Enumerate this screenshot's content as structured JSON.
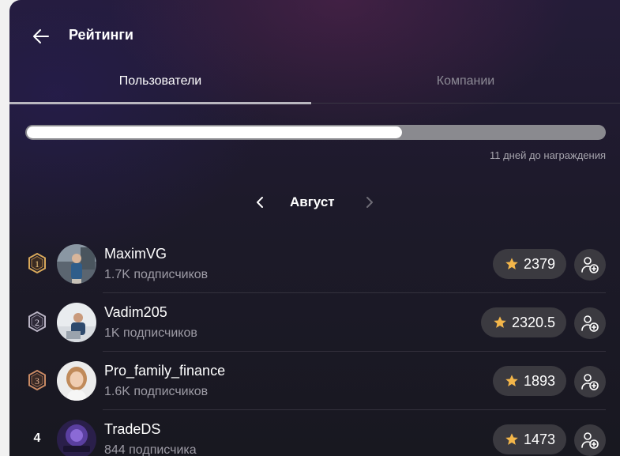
{
  "header": {
    "title": "Рейтинги"
  },
  "tabs": [
    {
      "label": "Пользователи",
      "active": true
    },
    {
      "label": "Компании",
      "active": false
    }
  ],
  "progress": {
    "fraction": 0.65,
    "label": "11 дней до награждения"
  },
  "month": {
    "label": "Август"
  },
  "colors": {
    "star": "#f3b64a",
    "medal_gold": "#d8a85a",
    "medal_silver": "#b9b3c4",
    "medal_bronze": "#c98a64"
  },
  "users": [
    {
      "rank": "1",
      "medal": "gold",
      "name": "MaximVG",
      "subscribers": "1.7K подписчиков",
      "score": "2379"
    },
    {
      "rank": "2",
      "medal": "silver",
      "name": "Vadim205",
      "subscribers": "1K подписчиков",
      "score": "2320.5"
    },
    {
      "rank": "3",
      "medal": "bronze",
      "name": "Pro_family_finance",
      "subscribers": "1.6K подписчиков",
      "score": "1893"
    },
    {
      "rank": "4",
      "medal": "",
      "name": "TradeDS",
      "subscribers": "844 подписчика",
      "score": "1473"
    }
  ],
  "icons": {
    "back": "arrow-left-icon",
    "prev": "chevron-left-icon",
    "next": "chevron-right-icon",
    "star": "star-icon",
    "follow": "add-user-icon"
  }
}
